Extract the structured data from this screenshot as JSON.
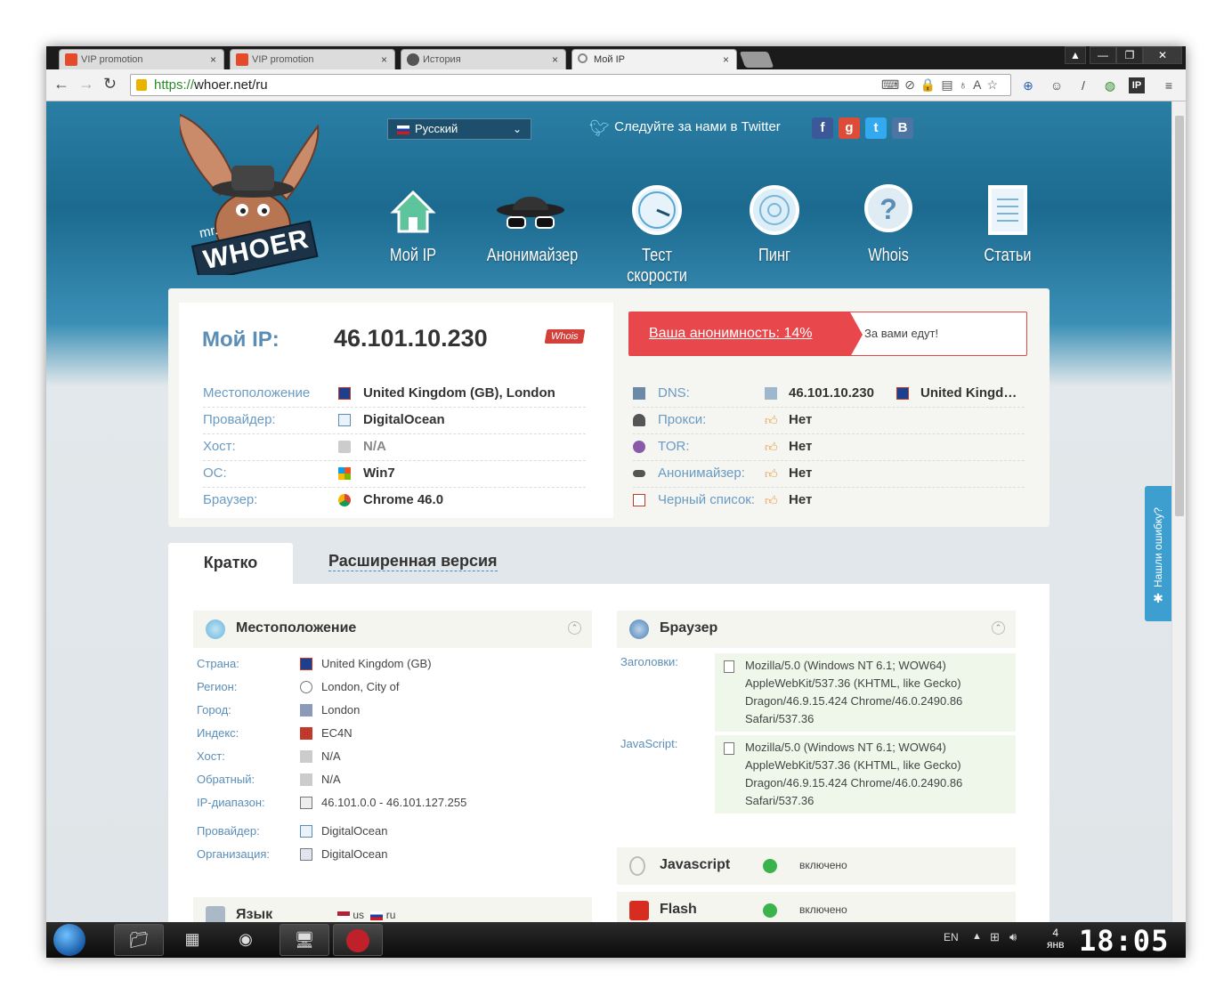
{
  "browser": {
    "tabs": [
      {
        "title": "VIP promotion",
        "color": "#e34b2a"
      },
      {
        "title": "VIP promotion",
        "color": "#e34b2a"
      },
      {
        "title": "История",
        "color": "#555555"
      },
      {
        "title": "Мой IP",
        "color": "#888888"
      }
    ],
    "close_glyph": "×",
    "url_scheme": "https://",
    "url_rest": "whoer.net/ru",
    "window_controls": [
      "▲",
      "—",
      "❐",
      "✕"
    ]
  },
  "header": {
    "logo_small": "mr.",
    "logo_text": "WHOER",
    "language": "Русский",
    "twitter_text": "Следуйте за нами в Twitter",
    "social": [
      {
        "glyph": "f",
        "color": "#3b5998"
      },
      {
        "glyph": "g",
        "color": "#dd4b39"
      },
      {
        "glyph": "t",
        "color": "#33aaf0"
      },
      {
        "glyph": "B",
        "color": "#4c75a3"
      }
    ],
    "nav": [
      "Мой IP",
      "Анонимайзер",
      "Тест скорости",
      "Пинг",
      "Whois",
      "Статьи"
    ]
  },
  "ip": {
    "title": "Мой IP:",
    "value": "46.101.10.230",
    "whois_badge": "Whois",
    "anonymity": "Ваша анонимность: 14%",
    "anonymity_note": "За вами едут!",
    "rows": [
      {
        "label": "Местоположение",
        "value": "United Kingdom (GB), London"
      },
      {
        "label": "Провайдер:",
        "value": "DigitalOcean"
      },
      {
        "label": "Хост:",
        "value": "N/A"
      },
      {
        "label": "ОС:",
        "value": "Win7"
      },
      {
        "label": "Браузер:",
        "value": "Chrome 46.0"
      }
    ],
    "right_rows": [
      {
        "label": "DNS:",
        "value": "46.101.10.230",
        "extra": "United Kingd…"
      },
      {
        "label": "Прокси:",
        "value": "Нет"
      },
      {
        "label": "TOR:",
        "value": "Нет"
      },
      {
        "label": "Анонимайзер:",
        "value": "Нет"
      },
      {
        "label": "Черный список:",
        "value": "Нет"
      }
    ]
  },
  "tabs": {
    "brief": "Кратко",
    "extended": "Расширенная версия"
  },
  "location": {
    "title": "Местоположение",
    "rows": [
      {
        "label": "Страна:",
        "value": "United Kingdom (GB)"
      },
      {
        "label": "Регион:",
        "value": "London, City of"
      },
      {
        "label": "Город:",
        "value": "London"
      },
      {
        "label": "Индекс:",
        "value": "EC4N"
      },
      {
        "label": "Хост:",
        "value": "N/A"
      },
      {
        "label": "Обратный:",
        "value": "N/A"
      },
      {
        "label": "IP-диапазон:",
        "value": "46.101.0.0 - 46.101.127.255"
      },
      {
        "label": "Провайдер:",
        "value": "DigitalOcean"
      },
      {
        "label": "Организация:",
        "value": "DigitalOcean"
      }
    ]
  },
  "language_section": {
    "title": "Язык",
    "values": [
      "us",
      "ru"
    ]
  },
  "browser_section": {
    "title": "Браузер",
    "headers_label": "Заголовки:",
    "headers_lines": [
      "Mozilla/5.0 (Windows NT 6.1; WOW64)",
      "AppleWebKit/537.36 (KHTML, like Gecko)",
      "Dragon/46.9.15.424 Chrome/46.0.2490.86",
      "Safari/537.36"
    ],
    "js_label": "JavaScript:",
    "js_lines": [
      "Mozilla/5.0 (Windows NT 6.1; WOW64)",
      "AppleWebKit/537.36 (KHTML, like Gecko)",
      "Dragon/46.9.15.424 Chrome/46.0.2490.86",
      "Safari/537.36"
    ]
  },
  "features": [
    {
      "title": "Javascript",
      "status": "включено"
    },
    {
      "title": "Flash",
      "status": "включено"
    }
  ],
  "bug_tab": "Нашли ошибку?",
  "taskbar": {
    "lang": "EN",
    "date_day": "4",
    "date_month": "янв",
    "time": "18:05"
  }
}
